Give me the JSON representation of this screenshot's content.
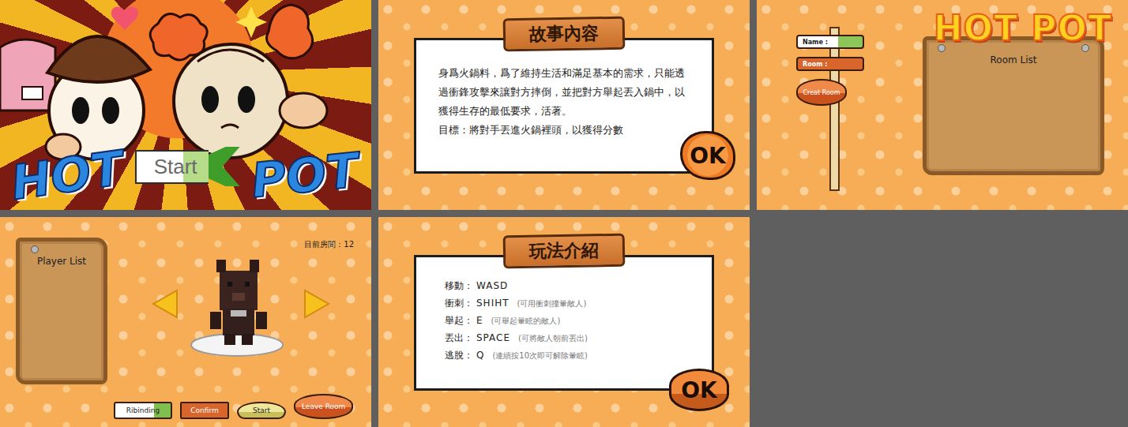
{
  "title_screen": {
    "logo_left": "HOT",
    "logo_right": "POT",
    "start_button": "Start"
  },
  "story_screen": {
    "header": "故事內容",
    "paragraphs": [
      "身爲火鍋料，爲了維持生活和滿足基本的需求，只能透過衝鋒攻擊來讓對方摔倒，並把對方舉起丟入鍋中，以獲得生存的最低要求，活著。",
      "目標：將對手丟進火鍋裡頭，以獲得分數"
    ],
    "ok_button": "OK"
  },
  "lobby_screen": {
    "logo": "HOT POT",
    "name_label": "Name :",
    "room_label": "Room :",
    "create_button": "Creat Room",
    "room_list_title": "Room List"
  },
  "room_screen": {
    "current_room_label": "目前房間：",
    "current_room": "12",
    "player_list_title": "Player List",
    "buttons": [
      "Ribinding",
      "Confirm",
      "Start",
      "Leave Room"
    ]
  },
  "controls_screen": {
    "header": "玩法介紹",
    "controls": [
      {
        "label": "移動：",
        "key": "WASD",
        "note": ""
      },
      {
        "label": "衝刺：",
        "key": "SHIHT",
        "note": "(可用衝刺撞暈敵人)"
      },
      {
        "label": "舉起：",
        "key": "E",
        "note": "(可舉起暈眩的敵人)"
      },
      {
        "label": "丟出：",
        "key": "SPACE",
        "note": "(可將敵人朝前丟出)"
      },
      {
        "label": "逃脫：",
        "key": "Q",
        "note": "(連續按10次即可解除暈眩)"
      }
    ],
    "ok_button": "OK"
  }
}
